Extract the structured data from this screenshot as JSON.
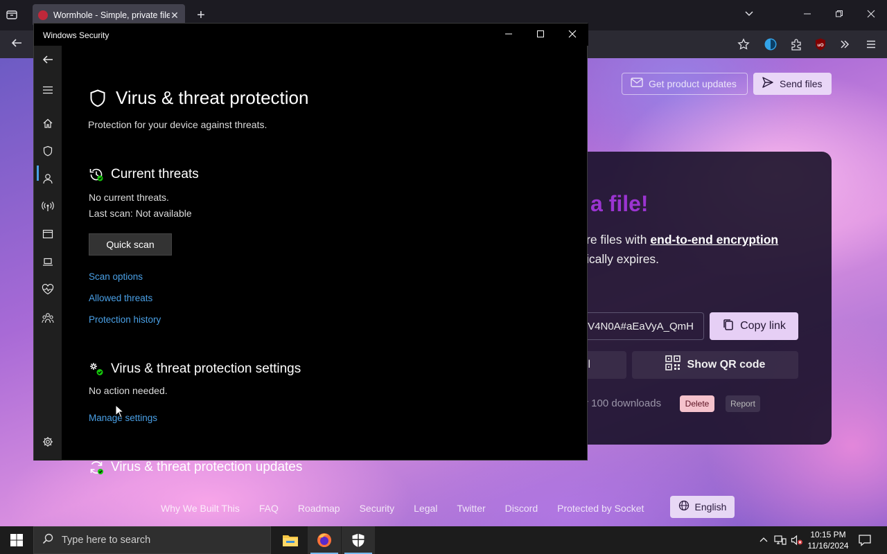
{
  "browser": {
    "tab_title": "Wormhole - Simple, private file",
    "tab_close": "✕",
    "new_tab": "+",
    "page": {
      "btn_updates": "Get product updates",
      "btn_send": "Send files",
      "headline": "a file!",
      "sub1_pre": "re files with ",
      "sub1_bold": "end-to-end encryption",
      "sub2": "ically expires.",
      "link_value": "V4N0A#aEaVyA_QmH",
      "copy_link": "Copy link",
      "share_left": "l",
      "show_qr": "Show QR code",
      "downloads": "r 100 downloads",
      "delete": "Delete",
      "report": "Report",
      "footer_links": [
        "Why We Built This",
        "FAQ",
        "Roadmap",
        "Security",
        "Legal",
        "Twitter",
        "Discord",
        "Protected by Socket"
      ],
      "language": "English"
    }
  },
  "security": {
    "window_title": "Windows Security",
    "heading": "Virus & threat protection",
    "subtitle": "Protection for your device against threats.",
    "current_threats": {
      "title": "Current threats",
      "status": "No current threats.",
      "last_scan": "Last scan: Not available",
      "quick_scan": "Quick scan",
      "links": [
        "Scan options",
        "Allowed threats",
        "Protection history"
      ]
    },
    "settings": {
      "title": "Virus & threat protection settings",
      "status": "No action needed.",
      "link": "Manage settings"
    },
    "updates": {
      "title": "Virus & threat protection updates"
    }
  },
  "taskbar": {
    "search_placeholder": "Type here to search",
    "time": "10:15 PM",
    "date": "11/16/2024"
  },
  "colors": {
    "accent_link": "#4aa0e6",
    "headline": "#9b34d1",
    "security_bg": "#000000"
  }
}
